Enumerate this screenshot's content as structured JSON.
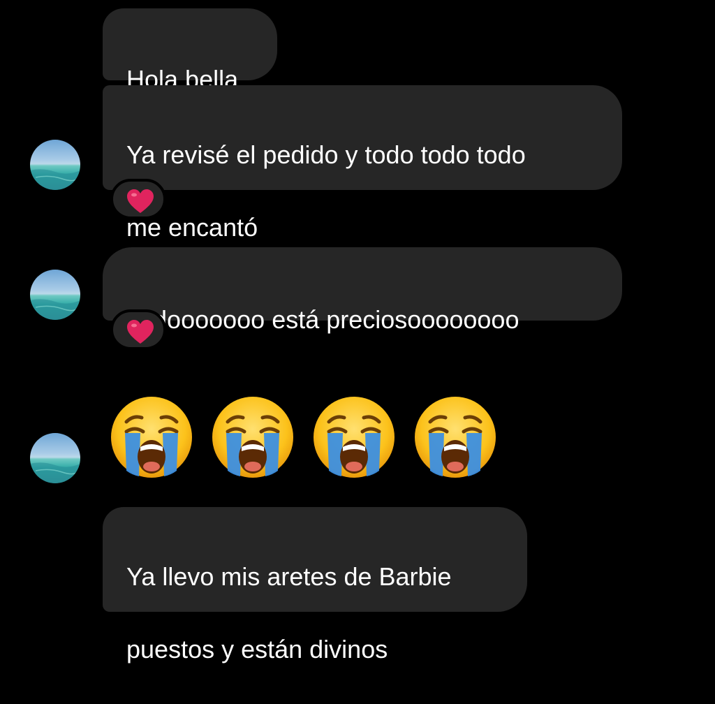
{
  "conversation": {
    "messages": [
      {
        "lines": [
          "Hola bella"
        ]
      },
      {
        "lines": [
          "Ya revisé el pedido y todo todo todo",
          "me encantó"
        ],
        "reaction": "red-heart"
      },
      {
        "lines": [
          "Todooooooo está preciosoooooooo"
        ],
        "reaction": "red-heart"
      },
      {
        "emojis": [
          "loudly-crying-face",
          "loudly-crying-face",
          "loudly-crying-face",
          "loudly-crying-face"
        ]
      },
      {
        "lines": [
          "Ya llevo mis aretes de Barbie",
          "puestos y están divinos"
        ]
      }
    ]
  },
  "colors": {
    "background": "#000000",
    "bubble": "#262626",
    "text": "#ffffff",
    "heart": "#e0245e"
  }
}
